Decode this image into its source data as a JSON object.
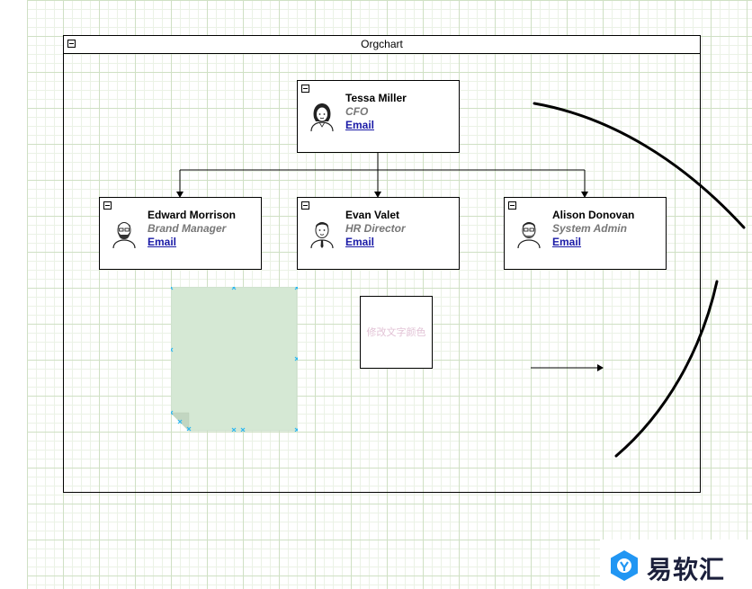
{
  "orgchart": {
    "title": "Orgchart"
  },
  "people": [
    {
      "name": "Tessa Miller",
      "role": "CFO",
      "email_label": "Email",
      "avatar_icon": "woman-avatar-icon"
    },
    {
      "name": "Edward Morrison",
      "role": "Brand Manager",
      "email_label": "Email",
      "avatar_icon": "bearded-man-avatar-icon"
    },
    {
      "name": "Evan Valet",
      "role": "HR Director",
      "email_label": "Email",
      "avatar_icon": "man-tie-avatar-icon"
    },
    {
      "name": "Alison Donovan",
      "role": "System Admin",
      "email_label": "Email",
      "avatar_icon": "glasses-man-avatar-icon"
    }
  ],
  "note": {
    "text": "修改文字颜色",
    "text_color": "#e2c3d6"
  },
  "sticky_note": {
    "fill_color": "#d5e8d4",
    "handle_color": "#29b6f2"
  },
  "watermark": {
    "brand_text": "易软汇",
    "logo_icon": "hexagon-logo-icon",
    "logo_color": "#2196f3"
  },
  "colors": {
    "grid_major": "#cfe0c4",
    "grid_minor": "#ebf2e6",
    "email_link": "#1a1aa6",
    "role_text": "#777777"
  }
}
